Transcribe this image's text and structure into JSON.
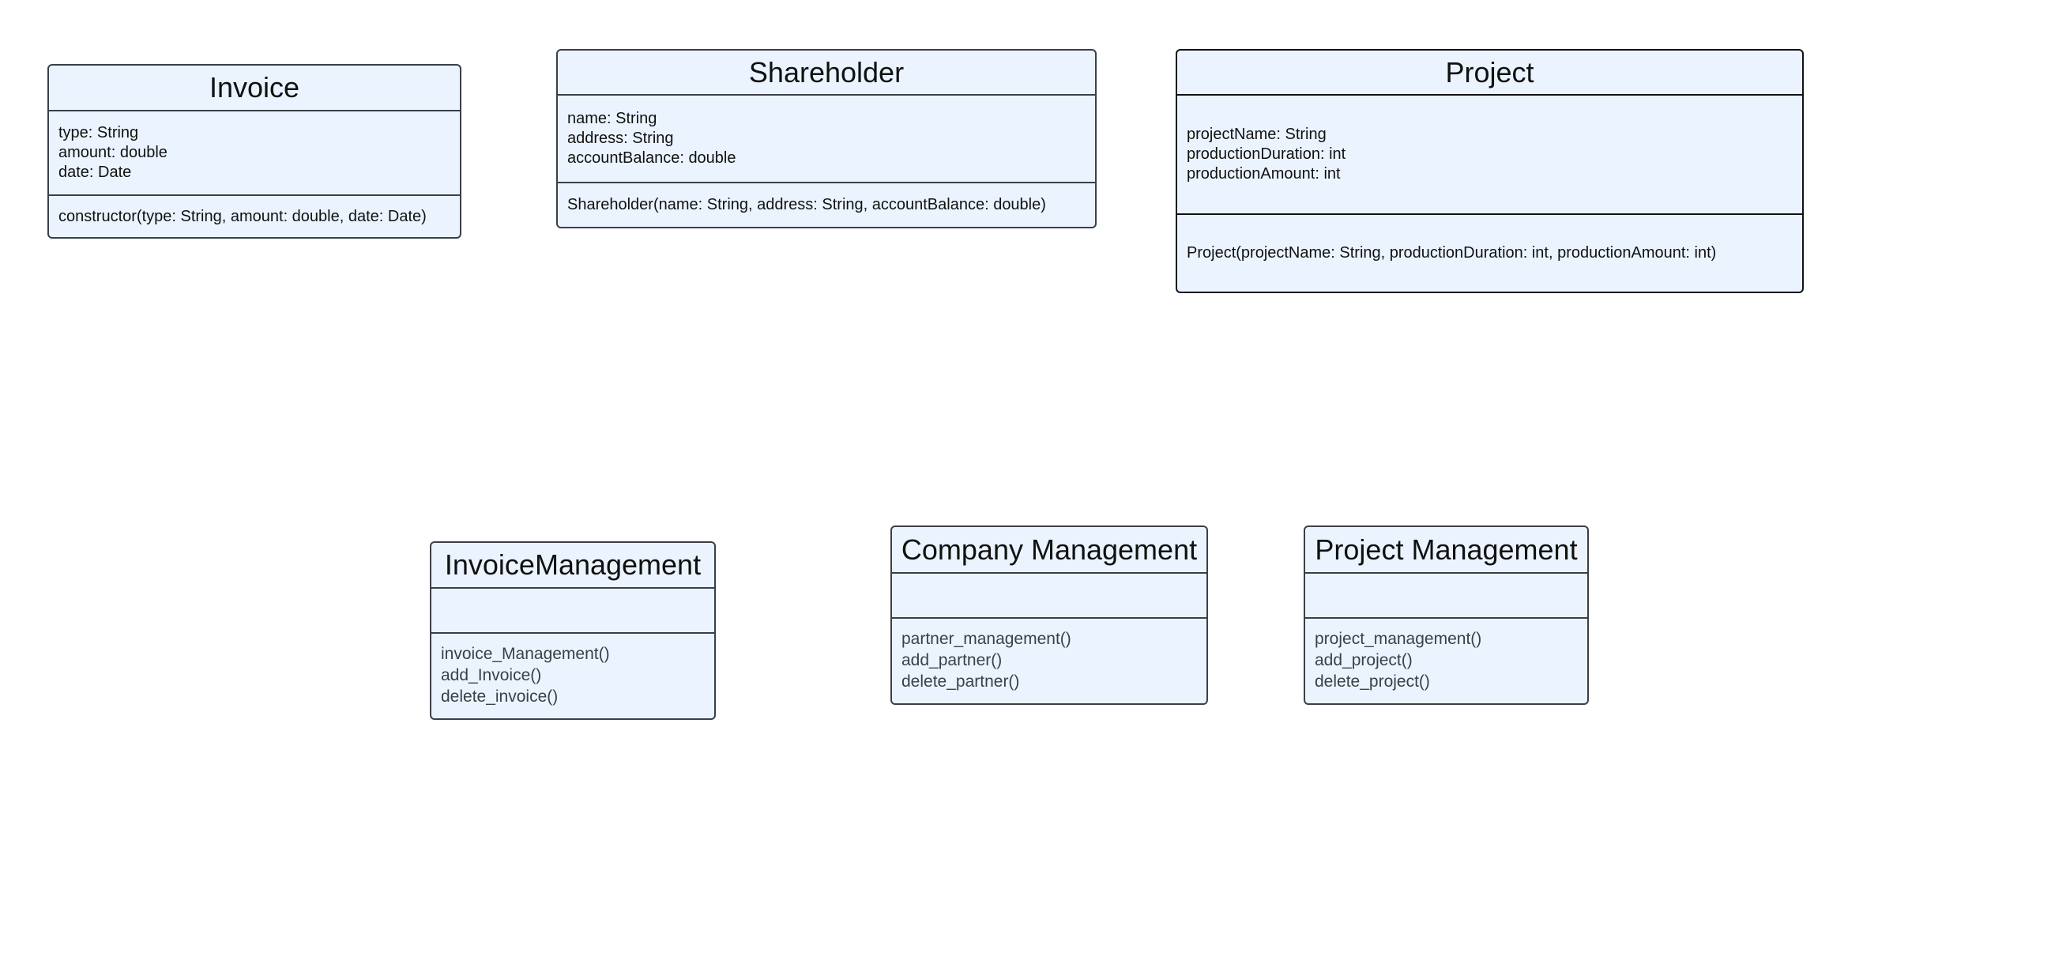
{
  "classes": {
    "invoice": {
      "name": "Invoice",
      "attributes": [
        "type: String",
        "amount: double",
        "date: Date"
      ],
      "methods": [
        "constructor(type: String, amount: double, date: Date)"
      ]
    },
    "shareholder": {
      "name": "Shareholder",
      "attributes": [
        "name: String",
        "address: String",
        "accountBalance: double"
      ],
      "methods": [
        "Shareholder(name: String, address: String, accountBalance: double)"
      ]
    },
    "project": {
      "name": "Project",
      "attributes": [
        "projectName: String",
        "productionDuration: int",
        "productionAmount: int"
      ],
      "methods": [
        "Project(projectName: String, productionDuration: int, productionAmount: int)"
      ]
    },
    "invoice_management": {
      "name": "InvoiceManagement",
      "methods": [
        "invoice_Management()",
        "add_Invoice()",
        "delete_invoice()"
      ]
    },
    "company_management": {
      "name": "Company Management",
      "methods": [
        "partner_management()",
        "add_partner()",
        "delete_partner()"
      ]
    },
    "project_management": {
      "name": "Project Management",
      "methods": [
        "project_management()",
        "add_project()",
        "delete_project()"
      ]
    }
  }
}
